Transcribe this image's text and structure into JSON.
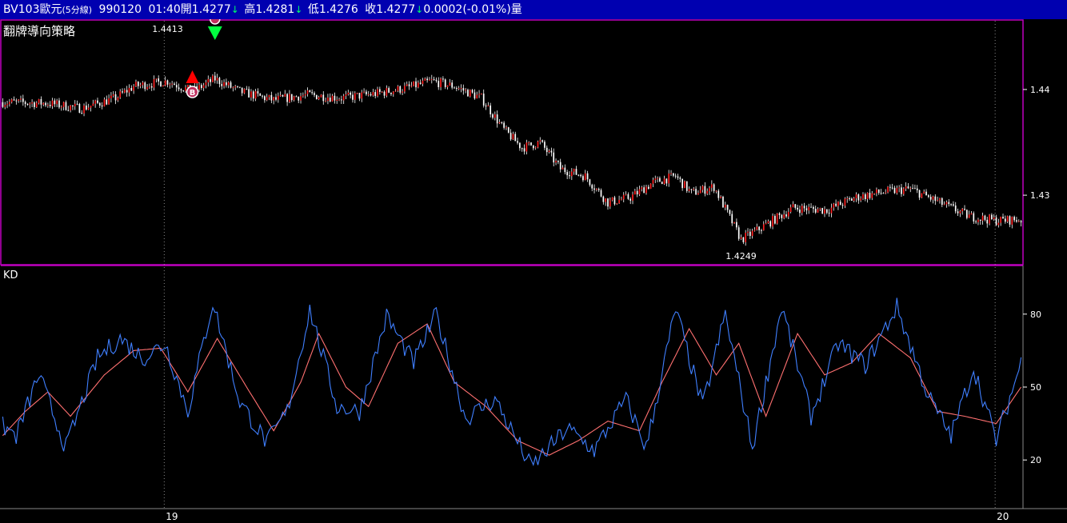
{
  "header": {
    "symbol": "BV103歐元",
    "interval": "(5分線)",
    "date": "990120",
    "time": "01:40",
    "open_label": "開",
    "open": "1.4277",
    "high_label": "高",
    "high": "1.4281",
    "low_label": "低",
    "low": "1.4276",
    "close_label": "收",
    "close": "1.4277",
    "change": "0.0002",
    "change_pct": "(-0.01%)",
    "volume_label": "量",
    "down_arrow": "↓"
  },
  "colors": {
    "header_bg": "#0000b0",
    "candle_up": "#ff2020",
    "candle_down": "#ffffff",
    "k_line": "#3f7fff",
    "d_line": "#ff7070",
    "panel_border": "#c000c0",
    "buy_marker": "#ff0000",
    "sell_marker": "#00ff40"
  },
  "chart_data": [
    {
      "type": "candlestick",
      "title": "翻牌導向策略",
      "ylim": [
        1.4235,
        1.4465
      ],
      "yticks": [
        1.43,
        1.44
      ],
      "ytick_labels": [
        "1.43",
        "1.44"
      ],
      "x_labels": [
        {
          "index": 72,
          "label": "19"
        },
        {
          "index": 440,
          "label": "20"
        }
      ],
      "annotations": [
        {
          "index": 73,
          "label": "1.4413",
          "position": "above"
        },
        {
          "index": 327,
          "label": "1.4249",
          "position": "below"
        }
      ],
      "signals": [
        {
          "index": 84,
          "type": "buy",
          "label": "B"
        },
        {
          "index": 94,
          "type": "sell"
        }
      ],
      "bar_count": 452,
      "close_anchors": [
        [
          0,
          1.4388
        ],
        [
          20,
          1.4387
        ],
        [
          35,
          1.4382
        ],
        [
          50,
          1.4392
        ],
        [
          58,
          1.4403
        ],
        [
          73,
          1.4408
        ],
        [
          84,
          1.4398
        ],
        [
          94,
          1.441
        ],
        [
          105,
          1.4398
        ],
        [
          120,
          1.439
        ],
        [
          135,
          1.4395
        ],
        [
          150,
          1.4392
        ],
        [
          165,
          1.4396
        ],
        [
          180,
          1.4402
        ],
        [
          190,
          1.4408
        ],
        [
          200,
          1.4403
        ],
        [
          212,
          1.4392
        ],
        [
          222,
          1.4362
        ],
        [
          230,
          1.4345
        ],
        [
          238,
          1.435
        ],
        [
          247,
          1.4325
        ],
        [
          258,
          1.4318
        ],
        [
          268,
          1.4293
        ],
        [
          278,
          1.4298
        ],
        [
          288,
          1.4312
        ],
        [
          298,
          1.4318
        ],
        [
          305,
          1.4302
        ],
        [
          315,
          1.4308
        ],
        [
          327,
          1.4258
        ],
        [
          335,
          1.4268
        ],
        [
          350,
          1.4288
        ],
        [
          365,
          1.4286
        ],
        [
          378,
          1.4298
        ],
        [
          390,
          1.4303
        ],
        [
          402,
          1.4306
        ],
        [
          415,
          1.4293
        ],
        [
          428,
          1.428
        ],
        [
          440,
          1.4276
        ],
        [
          451,
          1.4277
        ]
      ]
    },
    {
      "type": "line",
      "title": "KD",
      "ylim": [
        0,
        100
      ],
      "yticks": [
        20,
        50,
        80
      ],
      "ytick_labels": [
        "20",
        "50",
        "80"
      ],
      "series": [
        {
          "name": "K",
          "color": "#3f7fff"
        },
        {
          "name": "D",
          "color": "#ff7070"
        }
      ],
      "k_anchors": [
        [
          0,
          34
        ],
        [
          6,
          30
        ],
        [
          16,
          55
        ],
        [
          28,
          25
        ],
        [
          42,
          62
        ],
        [
          52,
          70
        ],
        [
          62,
          62
        ],
        [
          72,
          68
        ],
        [
          82,
          40
        ],
        [
          93,
          85
        ],
        [
          105,
          44
        ],
        [
          117,
          27
        ],
        [
          126,
          40
        ],
        [
          136,
          82
        ],
        [
          148,
          42
        ],
        [
          158,
          40
        ],
        [
          170,
          79
        ],
        [
          182,
          60
        ],
        [
          192,
          80
        ],
        [
          205,
          37
        ],
        [
          218,
          45
        ],
        [
          234,
          17
        ],
        [
          250,
          33
        ],
        [
          262,
          24
        ],
        [
          276,
          45
        ],
        [
          285,
          25
        ],
        [
          298,
          82
        ],
        [
          310,
          42
        ],
        [
          320,
          80
        ],
        [
          332,
          25
        ],
        [
          345,
          83
        ],
        [
          358,
          38
        ],
        [
          370,
          68
        ],
        [
          382,
          59
        ],
        [
          396,
          83
        ],
        [
          410,
          46
        ],
        [
          420,
          30
        ],
        [
          430,
          58
        ],
        [
          440,
          28
        ],
        [
          451,
          60
        ]
      ],
      "d_anchors": [
        [
          0,
          30
        ],
        [
          10,
          40
        ],
        [
          20,
          48
        ],
        [
          30,
          38
        ],
        [
          45,
          55
        ],
        [
          58,
          65
        ],
        [
          70,
          66
        ],
        [
          82,
          48
        ],
        [
          95,
          70
        ],
        [
          108,
          50
        ],
        [
          120,
          32
        ],
        [
          132,
          52
        ],
        [
          140,
          72
        ],
        [
          152,
          50
        ],
        [
          162,
          42
        ],
        [
          175,
          68
        ],
        [
          188,
          76
        ],
        [
          200,
          52
        ],
        [
          214,
          42
        ],
        [
          228,
          28
        ],
        [
          242,
          22
        ],
        [
          255,
          28
        ],
        [
          268,
          36
        ],
        [
          282,
          32
        ],
        [
          292,
          52
        ],
        [
          304,
          74
        ],
        [
          316,
          55
        ],
        [
          326,
          68
        ],
        [
          338,
          38
        ],
        [
          352,
          72
        ],
        [
          364,
          55
        ],
        [
          376,
          60
        ],
        [
          388,
          72
        ],
        [
          402,
          62
        ],
        [
          414,
          40
        ],
        [
          426,
          38
        ],
        [
          440,
          35
        ],
        [
          451,
          50
        ]
      ]
    }
  ]
}
